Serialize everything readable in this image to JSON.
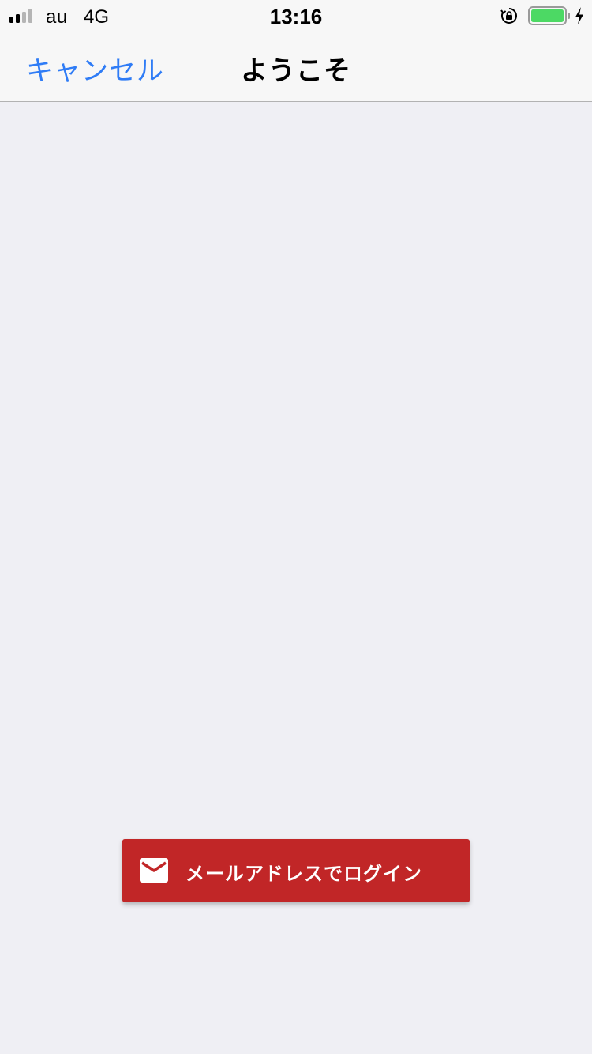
{
  "status_bar": {
    "carrier": "au",
    "network": "4G",
    "time": "13:16",
    "signal_bars_active": 2,
    "signal_bars_total": 4,
    "battery_level": 1.0,
    "battery_color": "#4cd964",
    "icons": [
      "signal-icon",
      "orientation-lock-icon",
      "battery-icon",
      "charging-icon"
    ]
  },
  "nav": {
    "cancel_label": "キャンセル",
    "title": "ようこそ"
  },
  "login": {
    "email_label": "メールアドレスでログイン",
    "icon": "mail-icon"
  },
  "colors": {
    "accent": "#2f7cf6",
    "button_red": "#c12627",
    "background": "#efeff4"
  }
}
